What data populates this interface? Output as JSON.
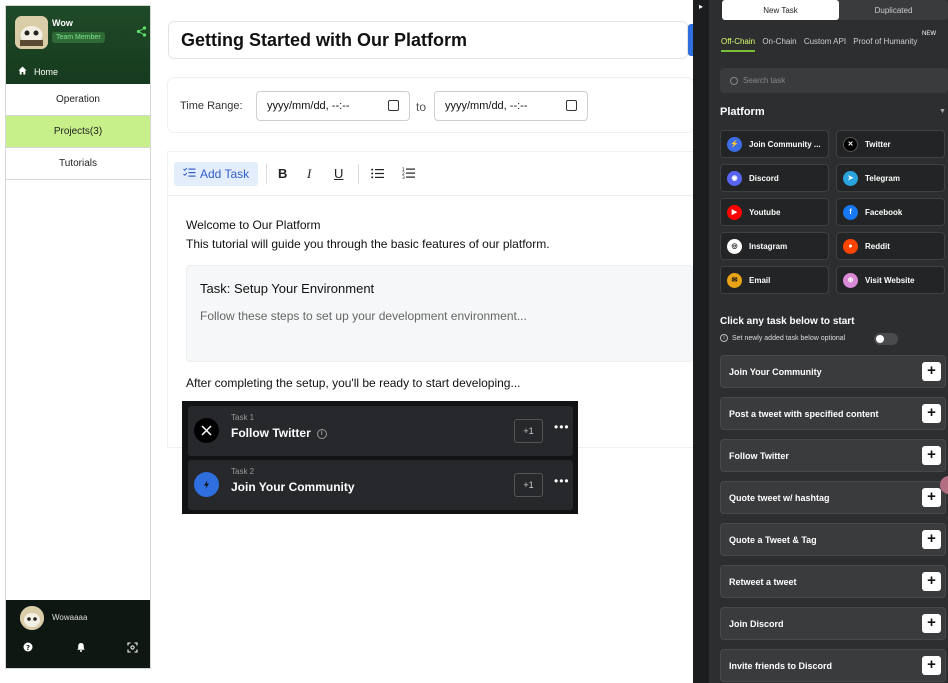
{
  "sidebar": {
    "user_name": "Wow",
    "role_badge": "Team Member",
    "home_label": "Home",
    "menu": [
      "Operation",
      "Projects(3)",
      "Tutorials"
    ],
    "footer_name": "Wowaaaa"
  },
  "main": {
    "title": "Getting Started with Our Platform",
    "range_label": "Time Range:",
    "date_from": "yyyy/mm/dd, --:--",
    "range_to": "to",
    "date_to": "yyyy/mm/dd, --:--",
    "add_task_label": "Add Task",
    "welcome_heading": "Welcome to Our Platform",
    "welcome_text": "This tutorial will guide you through the basic features of our platform.",
    "card_title": "Task: Setup Your Environment",
    "card_desc": "Follow these steps to set up your development environment...",
    "after_text": "After completing the setup, you'll be ready to start developing...",
    "tasks": [
      {
        "number": "Task 1",
        "title": "Follow Twitter",
        "points": "+1",
        "icon": "x-icon"
      },
      {
        "number": "Task 2",
        "title": "Join Your Community",
        "points": "+1",
        "icon": "community-icon"
      }
    ]
  },
  "panel": {
    "tabs": [
      "New Task",
      "Duplicated"
    ],
    "subtabs": [
      "Off-Chain",
      "On-Chain",
      "Custom API",
      "Proof of Humanity"
    ],
    "new_badge": "NEW",
    "search_placeholder": "Search task",
    "platform_label": "Platform",
    "platforms": [
      {
        "label": "Join Community ...",
        "icon": "community-icon",
        "color": "#3b6ee8"
      },
      {
        "label": "Twitter",
        "icon": "x-icon",
        "color": "#000000"
      },
      {
        "label": "Discord",
        "icon": "discord-icon",
        "color": "#5865f2"
      },
      {
        "label": "Telegram",
        "icon": "telegram-icon",
        "color": "#2aa3df"
      },
      {
        "label": "Youtube",
        "icon": "youtube-icon",
        "color": "#ff0000"
      },
      {
        "label": "Facebook",
        "icon": "facebook-icon",
        "color": "#1877f2"
      },
      {
        "label": "Instagram",
        "icon": "instagram-icon",
        "color": "#111111"
      },
      {
        "label": "Reddit",
        "icon": "reddit-icon",
        "color": "#ff4500"
      },
      {
        "label": "Email",
        "icon": "email-icon",
        "color": "#e8a317"
      },
      {
        "label": "Visit Website",
        "icon": "website-icon",
        "color": "#d98ad6"
      }
    ],
    "click_heading": "Click any task below to start",
    "optional_label": "Set newly added task below optional",
    "task_rows": [
      "Join Your Community",
      "Post a tweet with specified content",
      "Follow Twitter",
      "Quote tweet w/ hashtag",
      "Quote a Tweet & Tag",
      "Retweet a tweet",
      "Join Discord",
      "Invite friends to Discord"
    ]
  }
}
